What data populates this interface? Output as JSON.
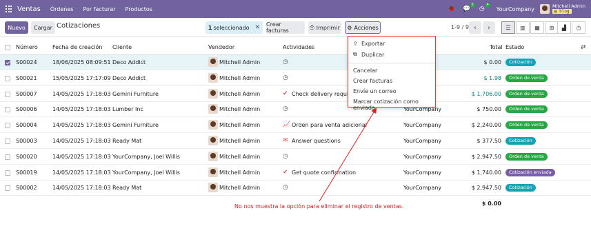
{
  "navbar": {
    "app_name": "Ventas",
    "menu": [
      "Órdenes",
      "Por facturar",
      "Productos"
    ],
    "messages_count": "5",
    "activities_count": "4",
    "company": "YourCompany",
    "user_name": "Mitchell Admin",
    "db_name": "blog"
  },
  "control": {
    "new_label": "Nuevo",
    "upload_label": "Cargar",
    "breadcrumb": "Cotizaciones",
    "selected_count": "1",
    "selected_label": "seleccionado",
    "create_invoices_label": "Crear facturas",
    "print_label": "Imprimir",
    "actions_label": "Acciones",
    "pager": "1-9 / 9"
  },
  "table": {
    "headers": {
      "number": "Número",
      "date": "Fecha de creación",
      "customer": "Cliente",
      "salesperson": "Vendedor",
      "activities": "Actividades",
      "total": "Total",
      "status": "Estado"
    },
    "rows": [
      {
        "number": "S00024",
        "date": "18/06/2025 08:09:51",
        "customer": "Deco Addict",
        "salesperson": "Mitchell Admin",
        "activity_icon": "clock-icon",
        "activity": "",
        "company": "",
        "total": "$ 0.00",
        "status": "Cotización",
        "status_color": "#17a2b8",
        "selected": true
      },
      {
        "number": "S00021",
        "date": "15/05/2025 17:17:09",
        "customer": "Deco Addict",
        "salesperson": "Mitchell Admin",
        "activity_icon": "clock-icon",
        "activity": "",
        "company": "",
        "total": "$ 1.98",
        "status": "Orden de venta",
        "status_color": "#28a745",
        "selected": false
      },
      {
        "number": "S00007",
        "date": "14/05/2025 17:18:03",
        "customer": "Gemini Furniture",
        "salesperson": "Mitchell Admin",
        "activity_icon": "check-icon",
        "activity": "Check delivery require",
        "company": "",
        "total": "$ 1,706.00",
        "status": "Orden de venta",
        "status_color": "#28a745",
        "selected": false
      },
      {
        "number": "S00006",
        "date": "14/05/2025 17:18:03",
        "customer": "Lumber Inc",
        "salesperson": "Mitchell Admin",
        "activity_icon": "clock-icon",
        "activity": "",
        "company": "YourCompany",
        "total": "$ 750.00",
        "status": "Orden de venta",
        "status_color": "#28a745",
        "selected": false
      },
      {
        "number": "S00004",
        "date": "14/05/2025 17:18:03",
        "customer": "Gemini Furniture",
        "salesperson": "Mitchell Admin",
        "activity_icon": "chart-icon",
        "activity": "Orden para venta adicional",
        "company": "YourCompany",
        "total": "$ 2,240.00",
        "status": "Orden de venta",
        "status_color": "#28a745",
        "selected": false
      },
      {
        "number": "S00003",
        "date": "14/05/2025 17:18:03",
        "customer": "Ready Mat",
        "salesperson": "Mitchell Admin",
        "activity_icon": "envelope-icon",
        "activity": "Answer questions",
        "company": "YourCompany",
        "total": "$ 377.50",
        "status": "Cotización",
        "status_color": "#17a2b8",
        "selected": false
      },
      {
        "number": "S00020",
        "date": "14/05/2025 17:18:03",
        "customer": "YourCompany, Joel Willis",
        "salesperson": "Mitchell Admin",
        "activity_icon": "clock-icon",
        "activity": "",
        "company": "YourCompany",
        "total": "$ 2,947.50",
        "status": "Orden de venta",
        "status_color": "#28a745",
        "selected": false
      },
      {
        "number": "S00019",
        "date": "14/05/2025 17:18:03",
        "customer": "YourCompany, Joel Willis",
        "salesperson": "Mitchell Admin",
        "activity_icon": "check-icon",
        "activity": "Get quote confirmation",
        "company": "YourCompany",
        "total": "$ 1,740.00",
        "status": "Cotización enviada",
        "status_color": "#7b5fa6",
        "selected": false
      },
      {
        "number": "S00002",
        "date": "14/05/2025 17:18:03",
        "customer": "Ready Mat",
        "salesperson": "Mitchell Admin",
        "activity_icon": "clock-icon",
        "activity": "",
        "company": "YourCompany",
        "total": "$ 2,947.50",
        "status": "Cotización",
        "status_color": "#17a2b8",
        "selected": false
      }
    ],
    "grand_total": "$ 0.00"
  },
  "actions_menu": {
    "export": "Exportar",
    "duplicate": "Duplicar",
    "cancel": "Cancelar",
    "create_invoices": "Crear facturas",
    "send_email": "Envíe un correo",
    "mark_sent": "Marcar cotización como enviada"
  },
  "annotation": {
    "text": "No nos muestra la opción para eliminar el registro de ventas.",
    "color": "#e01e1e"
  }
}
